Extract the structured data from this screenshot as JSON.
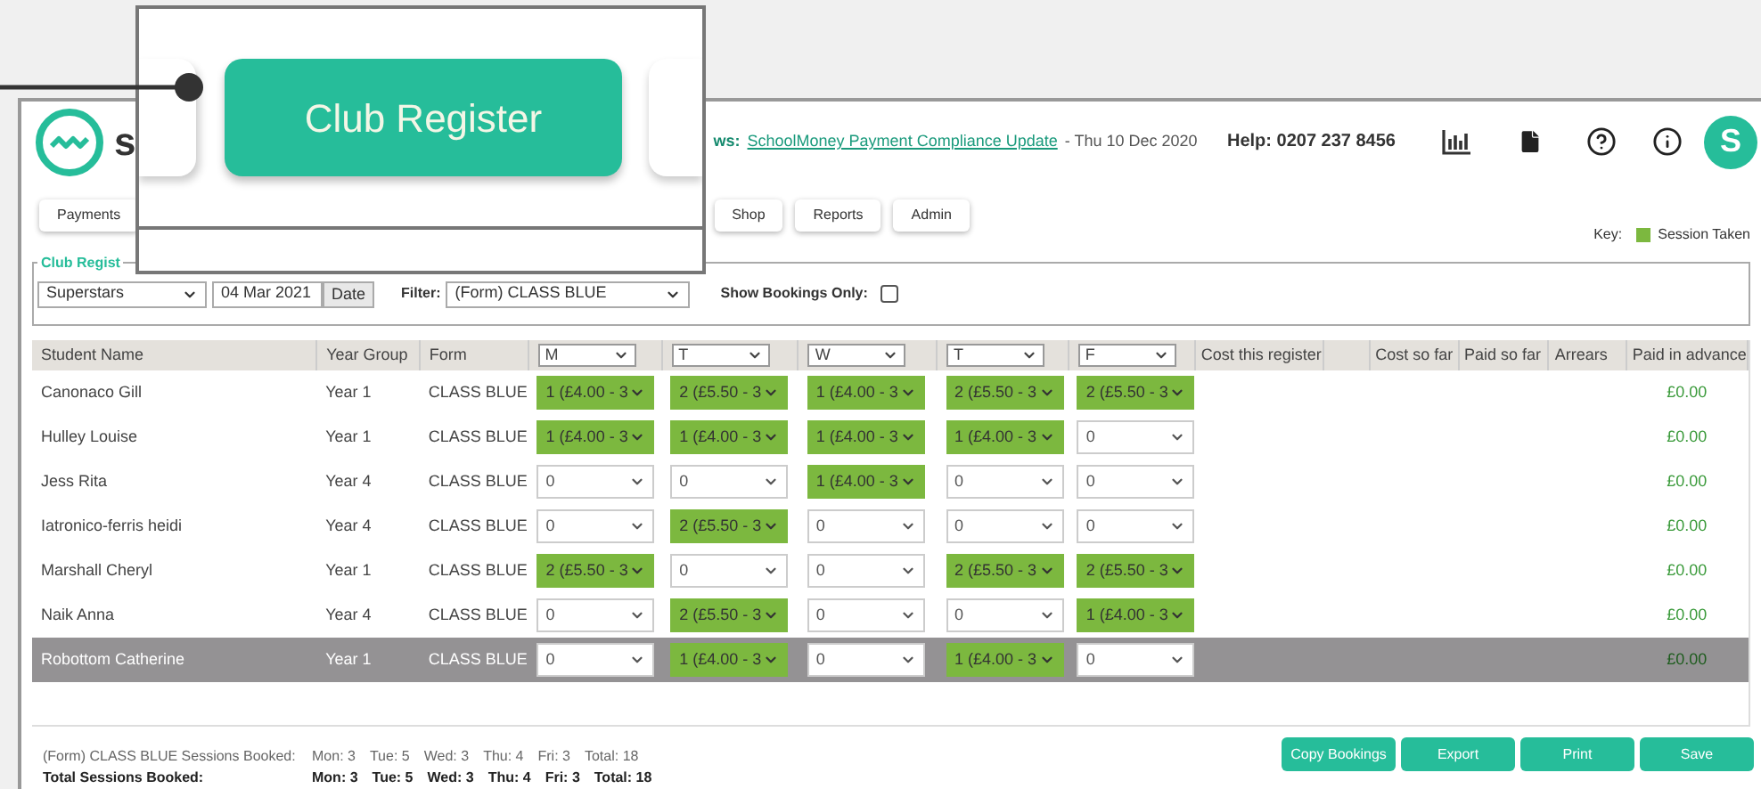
{
  "header": {
    "logo_text": "s",
    "news_label": "ws:",
    "news_link": "SchoolMoney Payment Compliance Update",
    "news_date": "- Thu 10 Dec 2020",
    "help": "Help: 0207 237 8456",
    "avatar": "S"
  },
  "callout": {
    "button": "Club Register"
  },
  "nav": [
    "Payments",
    "Shop",
    "Reports",
    "Admin"
  ],
  "key": {
    "label": "Key:",
    "item": "Session Taken"
  },
  "register": {
    "legend": "Club Regist",
    "club": "Superstars",
    "date": "04 Mar 2021",
    "date_button": "Date",
    "filter_label": "Filter:",
    "filter": "(Form) CLASS BLUE",
    "bookings_only_label": "Show Bookings Only:",
    "bookings_only": false
  },
  "table": {
    "columns": [
      "Student Name",
      "Year Group",
      "Form"
    ],
    "days": [
      "M",
      "T",
      "W",
      "T",
      "F"
    ],
    "extra_columns": [
      "Cost this register",
      "",
      "Cost so far",
      "Paid so far",
      "Arrears",
      "Paid in advance"
    ],
    "rows": [
      {
        "name": "Canonaco Gill",
        "year": "Year 1",
        "form": "CLASS BLUE",
        "selected": false,
        "paid_in_advance": "£0.00",
        "sessions": [
          {
            "value": "1 (£4.00 - 3",
            "booked": true
          },
          {
            "value": "2 (£5.50 - 3",
            "booked": true
          },
          {
            "value": "1 (£4.00 - 3",
            "booked": true
          },
          {
            "value": "2 (£5.50 - 3",
            "booked": true
          },
          {
            "value": "2 (£5.50 - 3",
            "booked": true
          }
        ]
      },
      {
        "name": "Hulley Louise",
        "year": "Year 1",
        "form": "CLASS BLUE",
        "selected": false,
        "paid_in_advance": "£0.00",
        "sessions": [
          {
            "value": "1 (£4.00 - 3",
            "booked": true
          },
          {
            "value": "1 (£4.00 - 3",
            "booked": true
          },
          {
            "value": "1 (£4.00 - 3",
            "booked": true
          },
          {
            "value": "1 (£4.00 - 3",
            "booked": true
          },
          {
            "value": "0",
            "booked": false
          }
        ]
      },
      {
        "name": "Jess Rita",
        "year": "Year 4",
        "form": "CLASS BLUE",
        "selected": false,
        "paid_in_advance": "£0.00",
        "sessions": [
          {
            "value": "0",
            "booked": false
          },
          {
            "value": "0",
            "booked": false
          },
          {
            "value": "1 (£4.00 - 3",
            "booked": true
          },
          {
            "value": "0",
            "booked": false
          },
          {
            "value": "0",
            "booked": false
          }
        ]
      },
      {
        "name": "Iatronico-ferris heidi",
        "year": "Year 4",
        "form": "CLASS BLUE",
        "selected": false,
        "paid_in_advance": "£0.00",
        "sessions": [
          {
            "value": "0",
            "booked": false
          },
          {
            "value": "2 (£5.50 - 3",
            "booked": true
          },
          {
            "value": "0",
            "booked": false
          },
          {
            "value": "0",
            "booked": false
          },
          {
            "value": "0",
            "booked": false
          }
        ]
      },
      {
        "name": "Marshall Cheryl",
        "year": "Year 1",
        "form": "CLASS BLUE",
        "selected": false,
        "paid_in_advance": "£0.00",
        "sessions": [
          {
            "value": "2 (£5.50 - 3",
            "booked": true
          },
          {
            "value": "0",
            "booked": false
          },
          {
            "value": "0",
            "booked": false
          },
          {
            "value": "2 (£5.50 - 3",
            "booked": true
          },
          {
            "value": "2 (£5.50 - 3",
            "booked": true
          }
        ]
      },
      {
        "name": "Naik Anna",
        "year": "Year 4",
        "form": "CLASS BLUE",
        "selected": false,
        "paid_in_advance": "£0.00",
        "sessions": [
          {
            "value": "0",
            "booked": false
          },
          {
            "value": "2 (£5.50 - 3",
            "booked": true
          },
          {
            "value": "0",
            "booked": false
          },
          {
            "value": "0",
            "booked": false
          },
          {
            "value": "1 (£4.00 - 3",
            "booked": true
          }
        ]
      },
      {
        "name": "Robottom Catherine",
        "year": "Year 1",
        "form": "CLASS BLUE",
        "selected": true,
        "paid_in_advance": "£0.00",
        "sessions": [
          {
            "value": "0",
            "booked": false
          },
          {
            "value": "1 (£4.00 - 3",
            "booked": true
          },
          {
            "value": "0",
            "booked": false
          },
          {
            "value": "1 (£4.00 - 3",
            "booked": true
          },
          {
            "value": "0",
            "booked": false
          }
        ]
      }
    ]
  },
  "summary": [
    {
      "kind": "form",
      "label": "(Form) CLASS BLUE Sessions Booked:",
      "counts": [
        "Mon: 3",
        "Tue: 5",
        "Wed: 3",
        "Thu: 4",
        "Fri: 3",
        "Total: 18"
      ]
    },
    {
      "kind": "total",
      "label": "Total Sessions Booked:",
      "counts": [
        "Mon: 3",
        "Tue: 5",
        "Wed: 3",
        "Thu: 4",
        "Fri: 3",
        "Total: 18"
      ]
    }
  ],
  "buttons": [
    "Copy Bookings",
    "Export",
    "Print",
    "Save"
  ]
}
